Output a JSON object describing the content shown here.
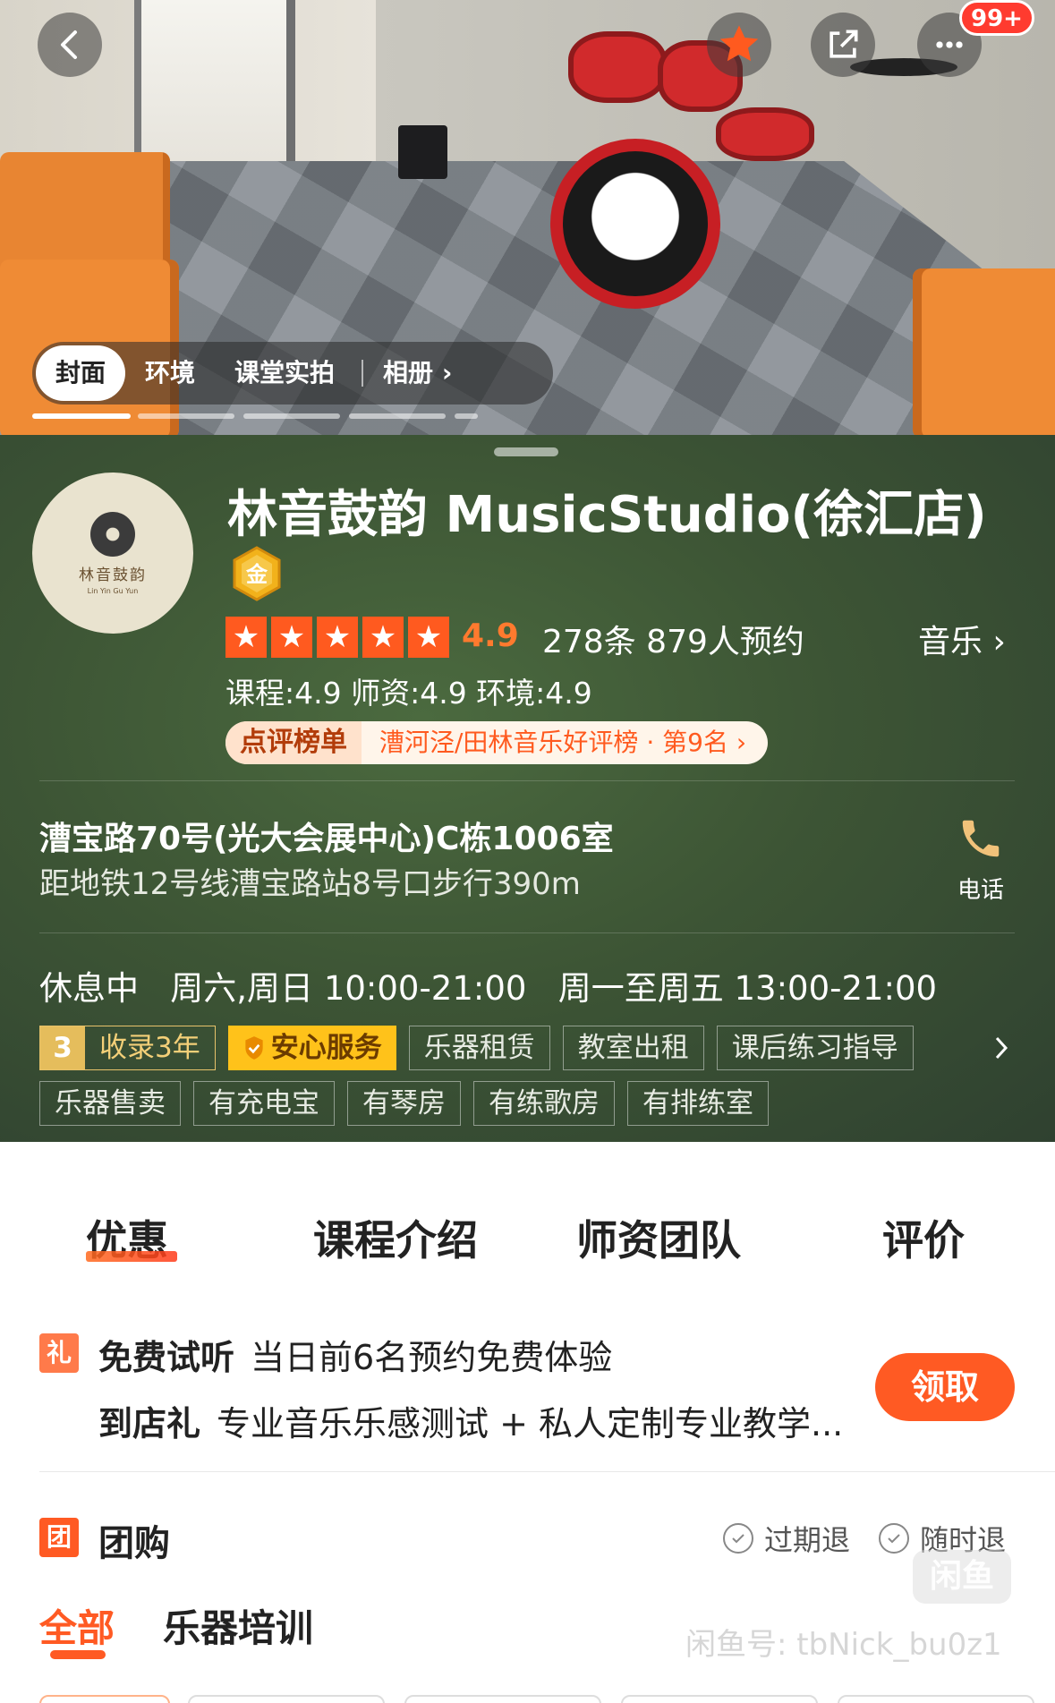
{
  "hero": {
    "photo_tabs": [
      "封面",
      "环境",
      "课堂实拍"
    ],
    "album_label": "相册",
    "notification_badge": "99+"
  },
  "shop": {
    "name": "林音鼓韵 MusicStudio(徐汇店)",
    "logo_text": "林音鼓韵",
    "logo_subtext": "Lin Yin Gu Yun",
    "gold_badge": "金",
    "rating_stars": 5,
    "score": "4.9",
    "review_count": "278条",
    "booking_count": "879人预约",
    "category": "音乐",
    "sub_scores": "课程:4.9  师资:4.9  环境:4.9",
    "rank_tag": "点评榜单",
    "rank_text": "漕河泾/田林音乐好评榜 · 第9名"
  },
  "location": {
    "address": "漕宝路70号(光大会展中心)C栋1006室",
    "metro": "距地铁12号线漕宝路站8号口步行390m",
    "phone_label": "电话"
  },
  "hours": {
    "status": "休息中",
    "weekend": "周六,周日 10:00-21:00",
    "weekday": "周一至周五 13:00-21:00"
  },
  "tags": {
    "years_num": "3",
    "years_text": "收录3年",
    "safe_service": "安心服务",
    "row1": [
      "乐器租赁",
      "教室出租",
      "课后练习指导"
    ],
    "row2": [
      "乐器售卖",
      "有充电宝",
      "有琴房",
      "有练歌房",
      "有排练室"
    ]
  },
  "tabs": [
    "优惠",
    "课程介绍",
    "师资团队",
    "评价"
  ],
  "offers": {
    "gift_icon": "礼",
    "line1_title": "免费试听",
    "line1_text": "当日前6名预约免费体验",
    "line2_title": "到店礼",
    "line2_text": "专业音乐乐感测试 + 私人定制专业教学...",
    "claim_label": "领取"
  },
  "group_buy": {
    "icon": "团",
    "title": "团购",
    "policy1": "过期退",
    "policy2": "随时退",
    "categories": [
      "全部",
      "乐器培训"
    ]
  },
  "watermark": {
    "logo": "闲鱼",
    "text": "闲鱼号: tbNick_bu0z1"
  },
  "colors": {
    "accent": "#ff5a23",
    "panel_green": "#3d5535",
    "star": "#ff5a1f",
    "gold": "#ffc21a"
  }
}
